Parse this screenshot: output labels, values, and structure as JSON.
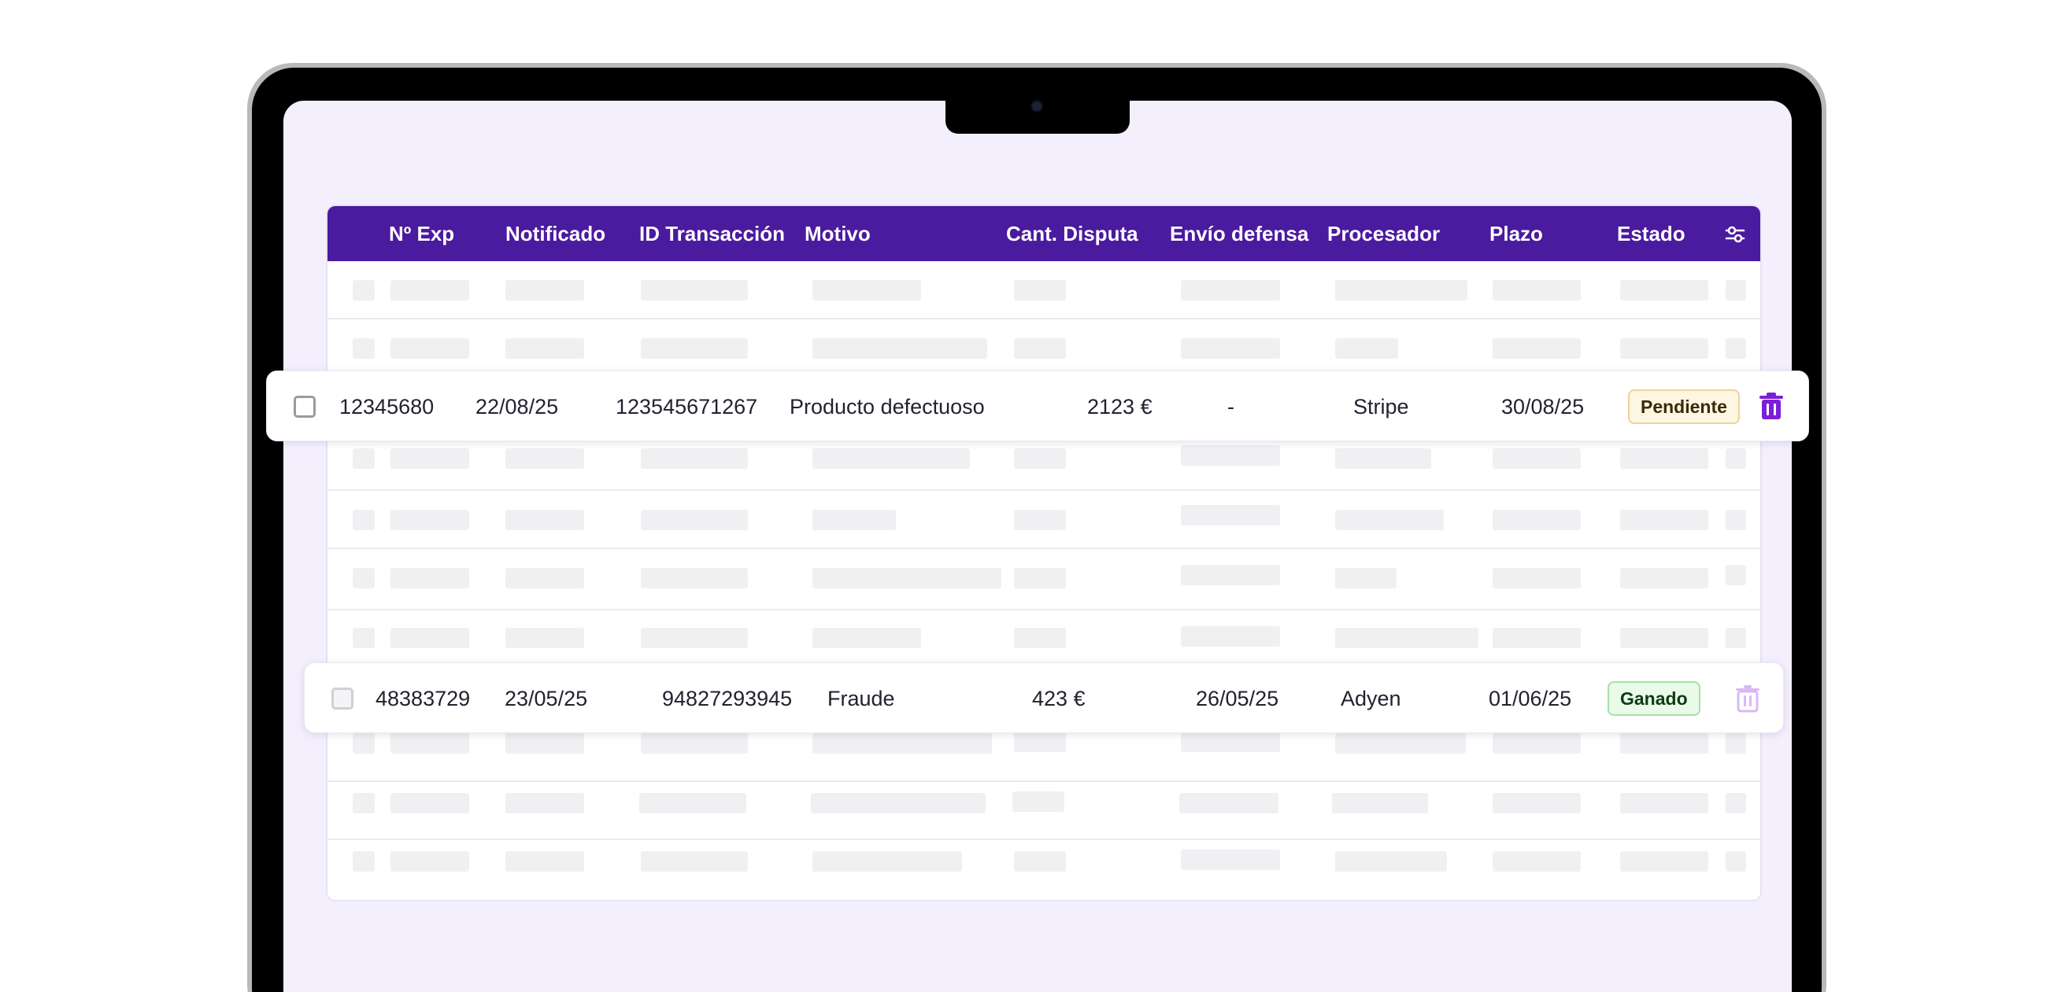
{
  "table": {
    "columns": [
      {
        "label": "Nº Exp"
      },
      {
        "label": "Notificado"
      },
      {
        "label": "ID Transacción"
      },
      {
        "label": "Motivo"
      },
      {
        "label": "Cant. Disputa"
      },
      {
        "label": "Envío defensa"
      },
      {
        "label": "Procesador"
      },
      {
        "label": "Plazo"
      },
      {
        "label": "Estado"
      }
    ],
    "filter_icon": "sliders-icon",
    "rows": [
      {
        "exp": "12345680",
        "notificado": "22/08/25",
        "id_transaccion": "123545671267",
        "motivo": "Producto defectuoso",
        "cantidad": "2123 €",
        "envio_defensa": "-",
        "procesador": "Stripe",
        "plazo": "30/08/25",
        "estado": "Pendiente",
        "estado_color": "#fdf6e2",
        "delete_icon": "trash-icon"
      },
      {
        "exp": "48383729",
        "notificado": "23/05/25",
        "id_transaccion": "94827293945",
        "motivo": "Fraude",
        "cantidad": "423 €",
        "envio_defensa": "26/05/25",
        "procesador": "Adyen",
        "plazo": "01/06/25",
        "estado": "Ganado",
        "estado_color": "#e9fae9",
        "delete_icon": "trash-icon"
      }
    ]
  },
  "colors": {
    "header_bg": "#4a1a9f",
    "screen_bg": "#f4effd",
    "accent": "#7a1fd6"
  }
}
